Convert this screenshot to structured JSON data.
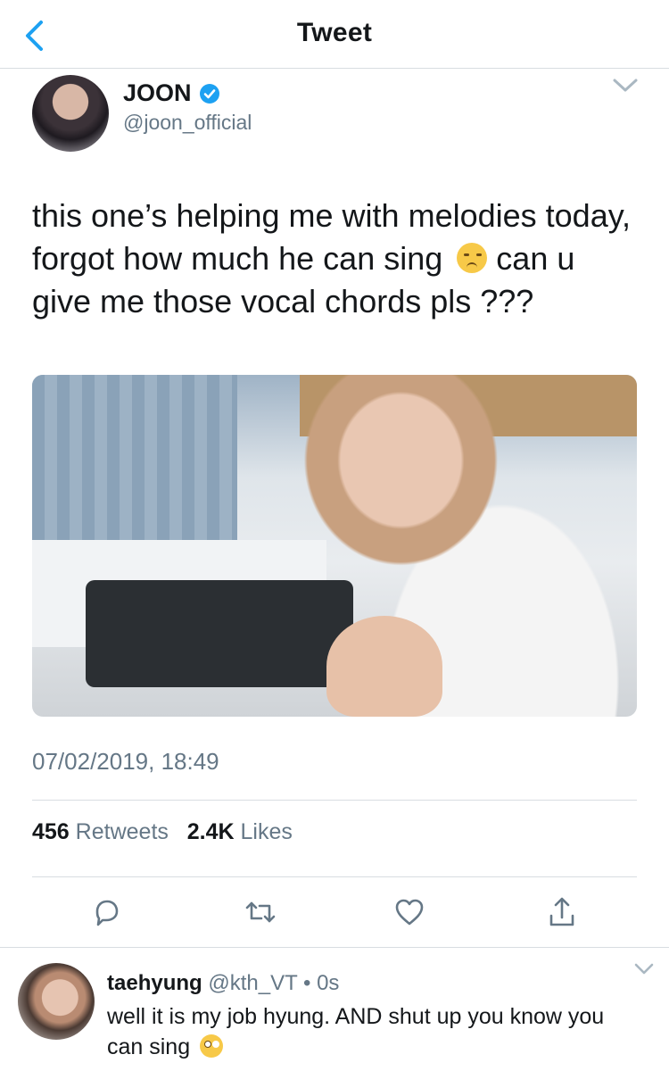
{
  "header": {
    "title": "Tweet"
  },
  "tweet": {
    "author": {
      "name": "JOON",
      "handle": "@joon_official"
    },
    "text": "this one’s helping me with melodies today, forgot how much he can sing",
    "text_tail": "can u give me those vocal chords pls ???",
    "timestamp": "07/02/2019, 18:49",
    "stats": {
      "retweets": "456",
      "retweets_label": "Retweets",
      "likes": "2.4K",
      "likes_label": "Likes"
    }
  },
  "reply": {
    "name": "taehyung",
    "handle": "@kth_VT",
    "age": "• 0s",
    "text": "well it is my job hyung. AND shut up you know you can sing"
  },
  "colors": {
    "accent": "#1DA1F2",
    "muted": "#657786",
    "divider": "#D8DDE1"
  },
  "icons": [
    "back-arrow-icon",
    "verified-badge-icon",
    "chevron-down-icon",
    "reply-icon",
    "retweet-icon",
    "like-icon",
    "share-icon"
  ]
}
